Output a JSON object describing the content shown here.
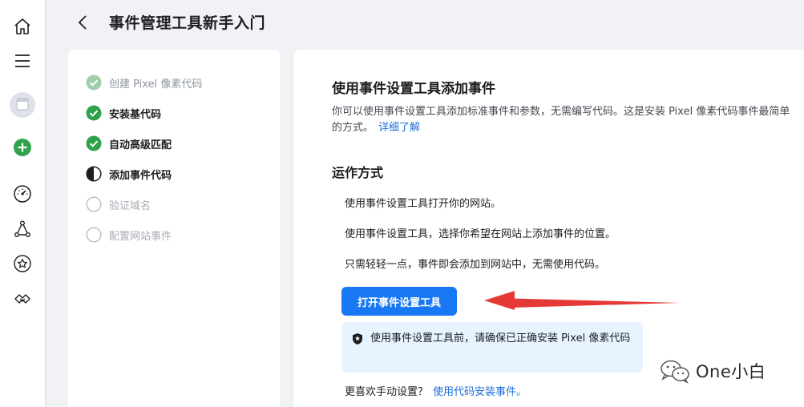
{
  "header": {
    "title": "事件管理工具新手入门"
  },
  "rail": {
    "icons": [
      "home-icon",
      "menu-icon",
      "account-avatar",
      "add-icon",
      "gauge-icon",
      "data-source-icon",
      "star-icon",
      "partner-icon"
    ],
    "add_color": "#31a24c"
  },
  "steps": [
    {
      "label": "创建 Pixel 像素代码",
      "state": "done-faded"
    },
    {
      "label": "安装基代码",
      "state": "done"
    },
    {
      "label": "自动高级匹配",
      "state": "done"
    },
    {
      "label": "添加事件代码",
      "state": "current"
    },
    {
      "label": "验证域名",
      "state": "pending"
    },
    {
      "label": "配置网站事件",
      "state": "pending"
    }
  ],
  "main": {
    "title": "使用事件设置工具添加事件",
    "description": "你可以使用事件设置工具添加标准事件和参数，无需编写代码。这是安装 Pixel 像素代码事件最简单的方式。",
    "learn_more": "详细了解",
    "how_title": "运作方式",
    "how_items": [
      "使用事件设置工具打开你的网站。",
      "使用事件设置工具，选择你希望在网站上添加事件的位置。",
      "只需轻轻一点，事件即会添加到网站中，无需使用代码。"
    ],
    "open_button": "打开事件设置工具",
    "notice": "使用事件设置工具前，请确保已正确安装 Pixel 像素代码",
    "manual_prompt": "更喜欢手动设置？",
    "manual_link": "使用代码安装事件。"
  },
  "watermark": {
    "text": "One小白"
  },
  "colors": {
    "primary": "#1877f2",
    "success": "#31a24c",
    "link": "#1a6ed8",
    "notice_bg": "#e7f3ff",
    "annotation_arrow": "#e53935"
  }
}
